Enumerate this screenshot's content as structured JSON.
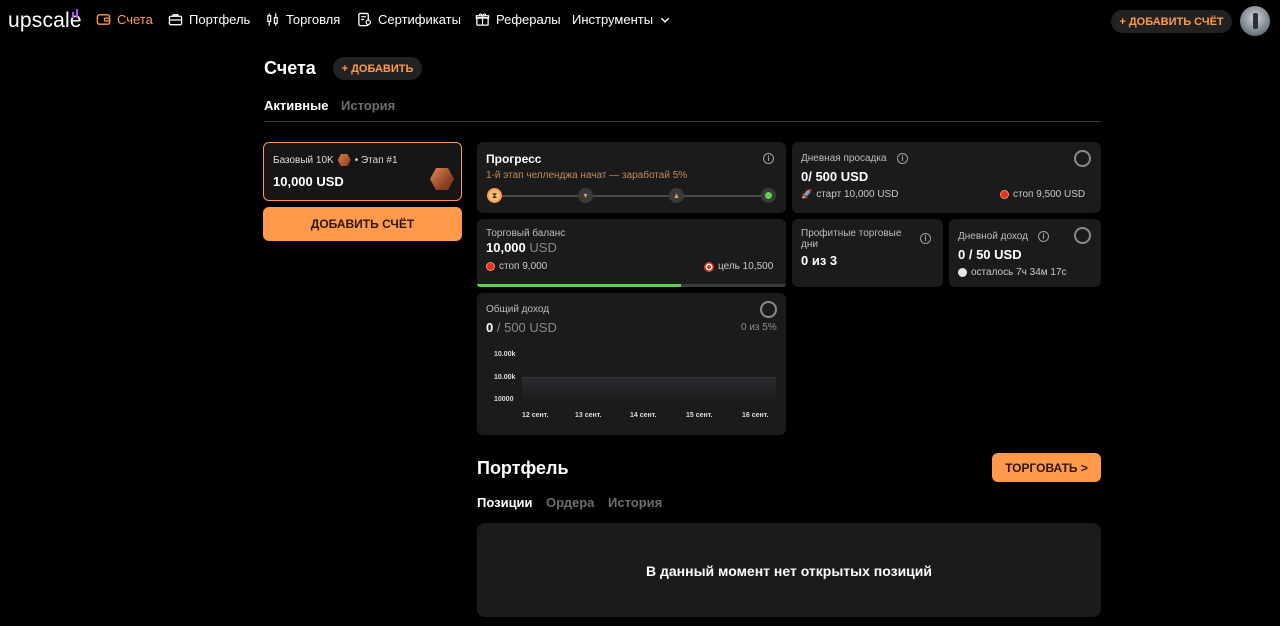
{
  "nav": {
    "logo": "upscale",
    "items": [
      {
        "label": "Счета",
        "icon": "wallet-icon",
        "active": true
      },
      {
        "label": "Портфель",
        "icon": "briefcase-icon"
      },
      {
        "label": "Торговля",
        "icon": "candles-icon"
      },
      {
        "label": "Сертификаты",
        "icon": "certificate-icon"
      },
      {
        "label": "Рефералы",
        "icon": "gift-icon"
      },
      {
        "label": "Инструменты",
        "icon": "chevron-down-icon"
      }
    ],
    "add_account": "+ ДОБАВИТЬ СЧЁТ"
  },
  "header": {
    "title": "Счета",
    "add_button": "+ ДОБАВИТЬ",
    "tabs": [
      "Активные",
      "История"
    ]
  },
  "account": {
    "name": "Базовый 10K",
    "stage": "• Этап #1",
    "balance": "10,000 USD",
    "add_button": "ДОБАВИТЬ СЧЁТ"
  },
  "progress": {
    "title": "Прогресс",
    "subtitle": "1-й этап челленджа начат — заработай 5%"
  },
  "daily_drawdown": {
    "title": "Дневная просадка",
    "value_main": "0/ 500 USD",
    "start": "старт 10,000 USD",
    "stop": "стоп 9,500 USD"
  },
  "trading_balance": {
    "title": "Торговый баланс",
    "value": "10,000",
    "unit": "USD",
    "stop": "стоп 9,000",
    "target": "цель 10,500",
    "progress": 0.66
  },
  "profit_days": {
    "title": "Профитные торговые дни",
    "value": "0 из 3"
  },
  "daily_income": {
    "title": "Дневной доход",
    "value": "0 / 50 USD",
    "remaining": "осталось 7ч 34м 17с"
  },
  "total_income": {
    "title": "Общий доход",
    "value": "0",
    "value_rest": "/ 500 USD",
    "ratio": "0 из 5%"
  },
  "chart_data": {
    "type": "area",
    "y_ticks": [
      "10.00k",
      "10.00k",
      "10000"
    ],
    "x": [
      "12 сент.",
      "13 сент.",
      "14 сент.",
      "15 сент.",
      "16 сент."
    ],
    "series": [
      {
        "values": [
          10000,
          10000,
          10000,
          10000,
          10000
        ]
      }
    ]
  },
  "portfolio": {
    "title": "Портфель",
    "trade_button": "ТОРГОВАТЬ >",
    "tabs": [
      "Позиции",
      "Ордера",
      "История"
    ],
    "empty": "В данный момент нет открытых позиций"
  },
  "colors": {
    "accent": "#ff9a4d",
    "card": "#1b1b1b",
    "green": "#5bd44a",
    "red": "#e2321b"
  }
}
